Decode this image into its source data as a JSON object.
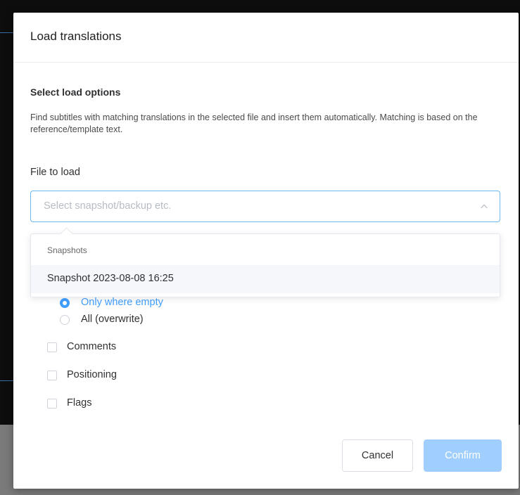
{
  "dialog": {
    "title": "Load translations",
    "section_title": "Select load options",
    "description": "Find subtitles with matching translations in the selected file and insert them automatically. Matching is based on the reference/template text."
  },
  "file_field": {
    "label": "File to load",
    "placeholder": "Select snapshot/backup etc.",
    "value": ""
  },
  "dropdown": {
    "group_label": "Snapshots",
    "options": [
      "Snapshot 2023-08-08 16:25"
    ],
    "hovered_index": 0
  },
  "overwrite_mode": {
    "options": [
      {
        "label": "Only where empty",
        "checked": true
      },
      {
        "label": "All (overwrite)",
        "checked": false
      }
    ]
  },
  "extras": [
    {
      "label": "Comments",
      "checked": false
    },
    {
      "label": "Positioning",
      "checked": false
    },
    {
      "label": "Flags",
      "checked": false
    }
  ],
  "footer": {
    "cancel_label": "Cancel",
    "confirm_label": "Confirm",
    "confirm_disabled": true
  },
  "colors": {
    "primary": "#409eff",
    "primary_disabled": "#a0cfff",
    "focus_border": "#6cb8f0"
  },
  "icons": {
    "select_toggle": "chevron-up-icon"
  }
}
